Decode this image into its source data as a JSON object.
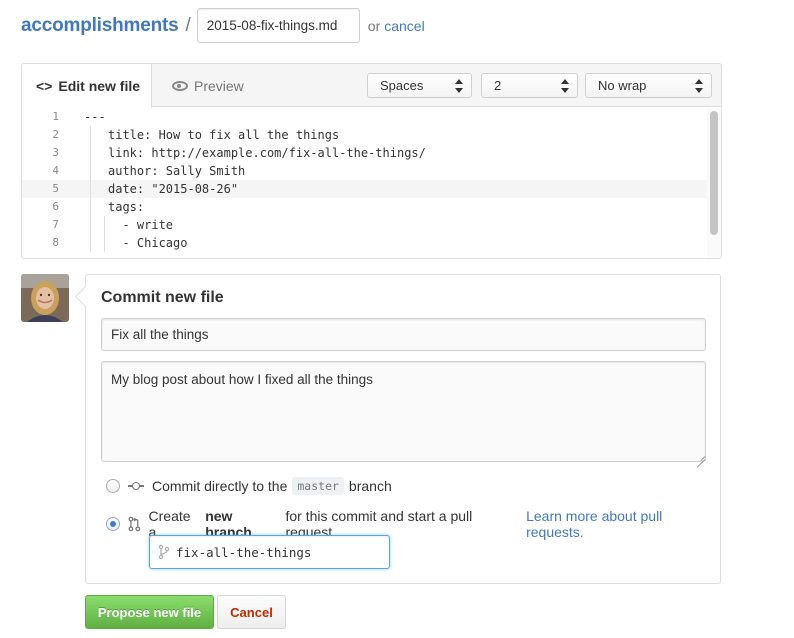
{
  "breadcrumb": {
    "repo": "accomplishments",
    "separator": "/",
    "filename": "2015-08-fix-things.md",
    "or_text": "or",
    "cancel": "cancel"
  },
  "editor": {
    "tabs": [
      {
        "label": "Edit new file",
        "icon": "code-icon",
        "active": true
      },
      {
        "label": "Preview",
        "icon": "eye-icon",
        "active": false
      }
    ],
    "indent_mode": "Spaces",
    "indent_size": "2",
    "wrap_mode": "No wrap",
    "active_line": 5,
    "lines": [
      {
        "num": "1",
        "text": "---"
      },
      {
        "num": "2",
        "text": "title: How to fix all the things"
      },
      {
        "num": "3",
        "text": "link: http://example.com/fix-all-the-things/"
      },
      {
        "num": "4",
        "text": "author: Sally Smith"
      },
      {
        "num": "5",
        "text": "date: \"2015-08-26\""
      },
      {
        "num": "6",
        "text": "tags:"
      },
      {
        "num": "7",
        "text": "  - write"
      },
      {
        "num": "8",
        "text": "  - Chicago"
      }
    ]
  },
  "commit": {
    "title": "Commit new file",
    "summary": "Fix all the things",
    "description": "My blog post about how I fixed all the things",
    "option_direct": {
      "prefix": "Commit directly to the",
      "branch": "master",
      "suffix": "branch",
      "checked": false
    },
    "option_new_branch": {
      "prefix": "Create a",
      "bold": "new branch",
      "suffix": "for this commit and start a pull request.",
      "link": "Learn more about pull requests.",
      "checked": true
    },
    "branch_name": "fix-all-the-things"
  },
  "actions": {
    "propose": "Propose new file",
    "cancel": "Cancel"
  },
  "colors": {
    "link": "#4078c0",
    "primary_button": "#60b044",
    "cancel_text": "#bd2c00",
    "focus_border": "#51a7e8"
  }
}
